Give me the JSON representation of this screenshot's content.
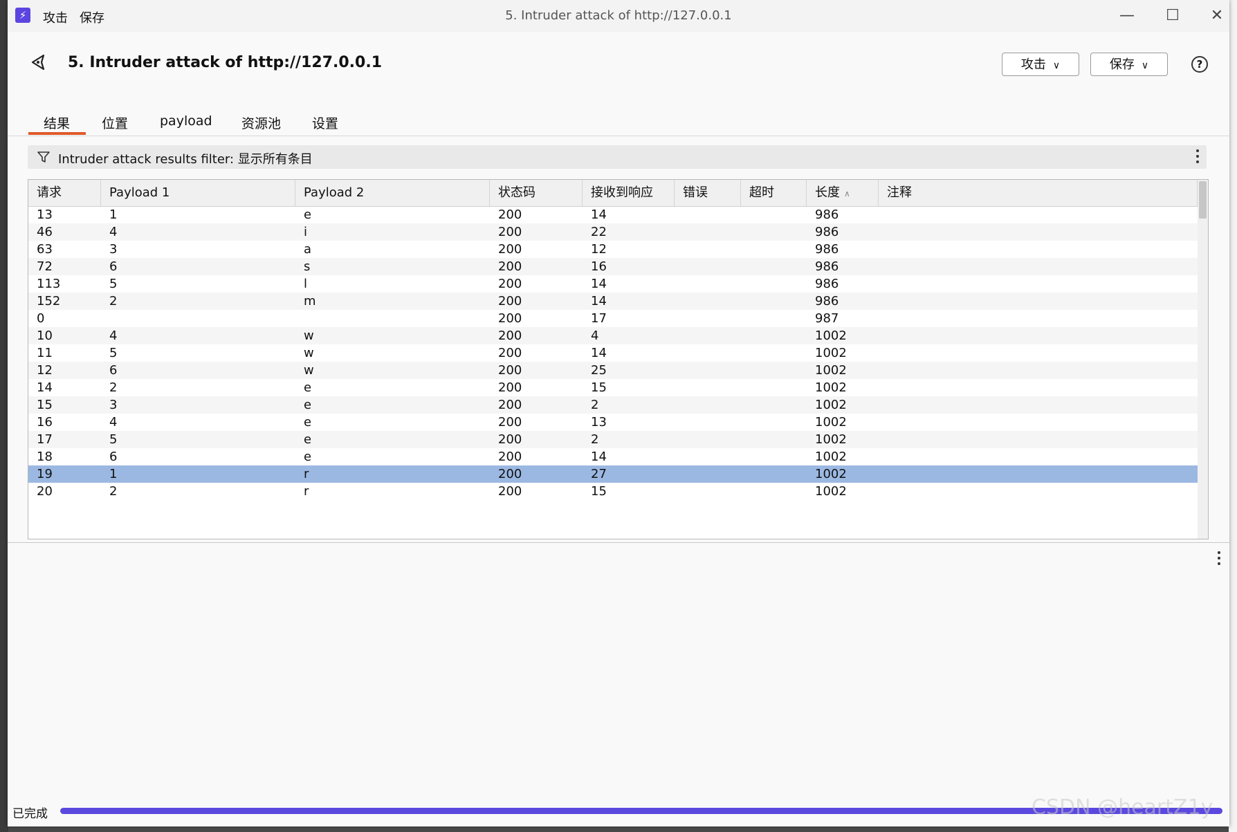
{
  "window": {
    "title": "5. Intruder attack of http://127.0.0.1",
    "menu": [
      "攻击",
      "保存"
    ],
    "controls": [
      "—",
      "☐",
      "✕"
    ]
  },
  "header": {
    "title": "5. Intruder attack of http://127.0.0.1",
    "attack_button": "攻击",
    "save_button": "保存",
    "help_label": "?"
  },
  "tabs": [
    "结果",
    "位置",
    "payload",
    "资源池",
    "设置"
  ],
  "active_tab": "结果",
  "filter": {
    "label": "Intruder attack results filter: 显示所有条目"
  },
  "table": {
    "columns": [
      "请求",
      "Payload 1",
      "Payload 2",
      "状态码",
      "接收到响应",
      "错误",
      "超时",
      "长度",
      "注释"
    ],
    "sorted_column": "长度",
    "selected_row_index": 15,
    "rows": [
      [
        "13",
        "1",
        "e",
        "200",
        "14",
        "",
        "",
        "986",
        ""
      ],
      [
        "46",
        "4",
        "i",
        "200",
        "22",
        "",
        "",
        "986",
        ""
      ],
      [
        "63",
        "3",
        "a",
        "200",
        "12",
        "",
        "",
        "986",
        ""
      ],
      [
        "72",
        "6",
        "s",
        "200",
        "16",
        "",
        "",
        "986",
        ""
      ],
      [
        "113",
        "5",
        "l",
        "200",
        "14",
        "",
        "",
        "986",
        ""
      ],
      [
        "152",
        "2",
        "m",
        "200",
        "14",
        "",
        "",
        "986",
        ""
      ],
      [
        "0",
        "",
        "",
        "200",
        "17",
        "",
        "",
        "987",
        ""
      ],
      [
        "10",
        "4",
        "w",
        "200",
        "4",
        "",
        "",
        "1002",
        ""
      ],
      [
        "11",
        "5",
        "w",
        "200",
        "14",
        "",
        "",
        "1002",
        ""
      ],
      [
        "12",
        "6",
        "w",
        "200",
        "25",
        "",
        "",
        "1002",
        ""
      ],
      [
        "14",
        "2",
        "e",
        "200",
        "15",
        "",
        "",
        "1002",
        ""
      ],
      [
        "15",
        "3",
        "e",
        "200",
        "2",
        "",
        "",
        "1002",
        ""
      ],
      [
        "16",
        "4",
        "e",
        "200",
        "13",
        "",
        "",
        "1002",
        ""
      ],
      [
        "17",
        "5",
        "e",
        "200",
        "2",
        "",
        "",
        "1002",
        ""
      ],
      [
        "18",
        "6",
        "e",
        "200",
        "14",
        "",
        "",
        "1002",
        ""
      ],
      [
        "19",
        "1",
        "r",
        "200",
        "27",
        "",
        "",
        "1002",
        ""
      ],
      [
        "20",
        "2",
        "r",
        "200",
        "15",
        "",
        "",
        "1002",
        ""
      ]
    ]
  },
  "status": {
    "text": "已完成",
    "progress": 1.0
  },
  "watermark": "CSDN @heartZ1y",
  "colors": {
    "accent": "#5b48df",
    "tab_underline": "#e05a2a",
    "selected_row": "#9bb8e2"
  }
}
